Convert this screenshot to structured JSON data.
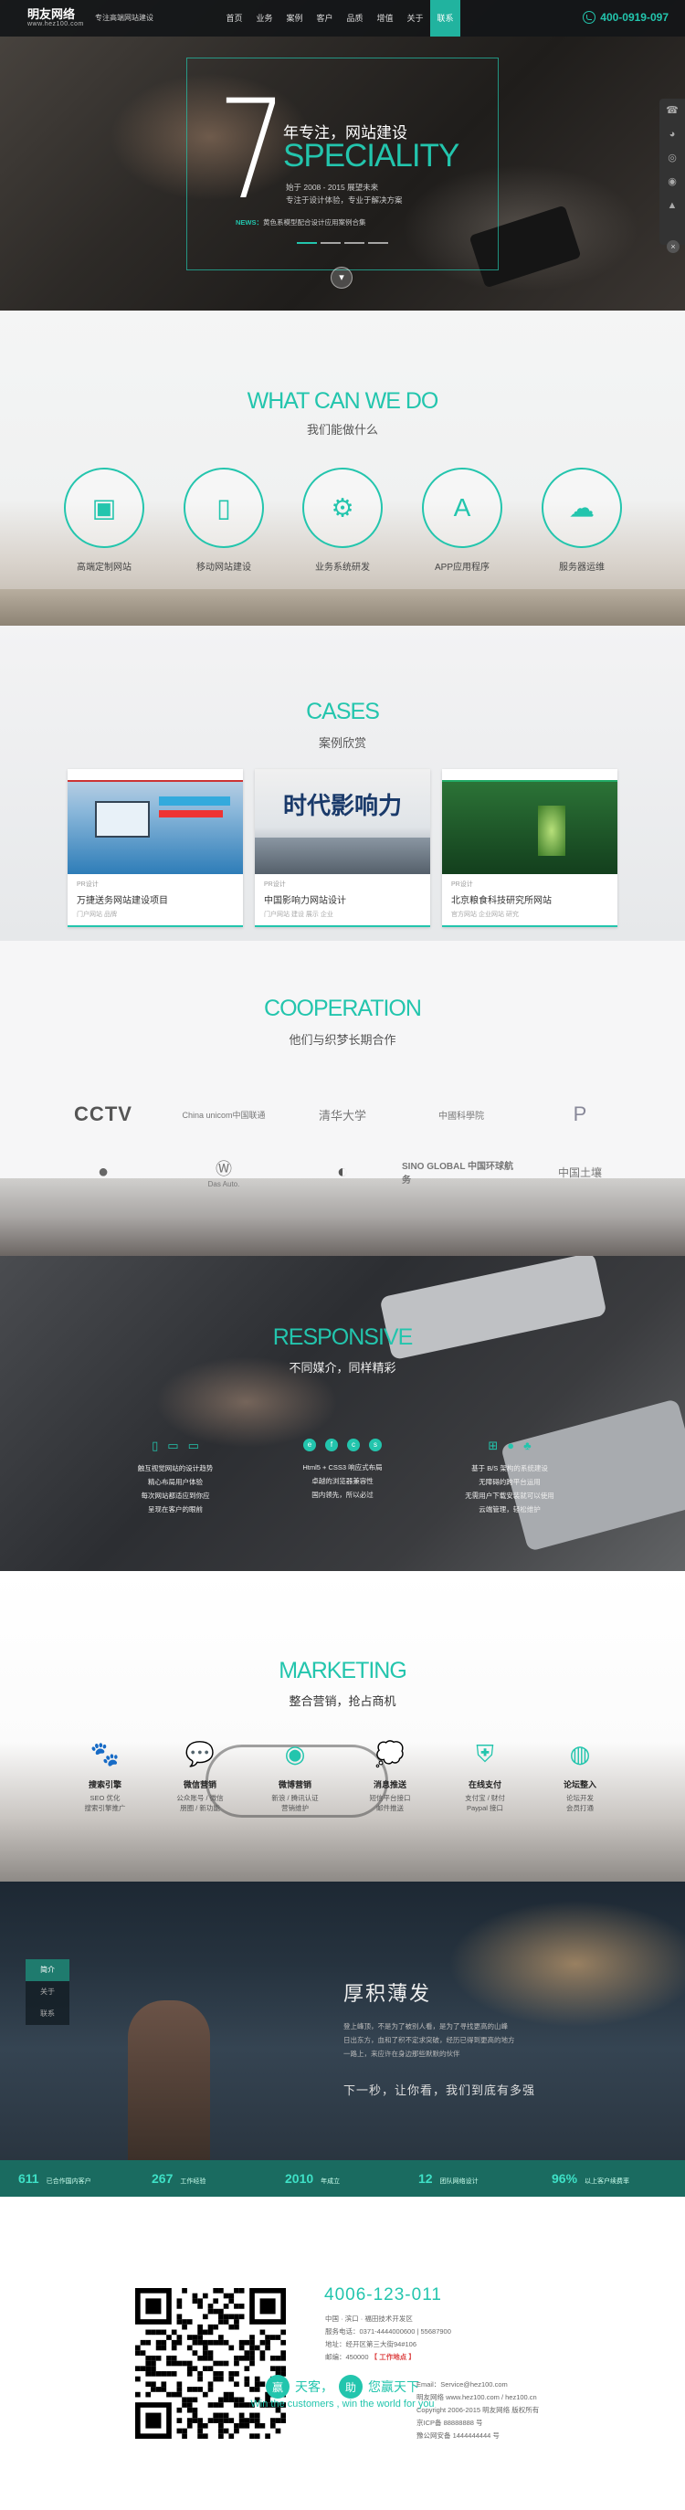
{
  "header": {
    "brand": "明友网络",
    "brand_url": "www.hez100.com",
    "slogan": "专注高端网站建设",
    "nav": [
      "首页",
      "业务",
      "案例",
      "客户",
      "品质",
      "增值",
      "关于",
      "联系"
    ],
    "phone": "400-0919-097"
  },
  "hero": {
    "big_number": "7",
    "line1": "年专注，网站建设",
    "speciality": "SPECIALITY",
    "small1": "始于 2008 - 2015 展望未来",
    "small2": "专注于设计体验，专业于解决方案",
    "news_label": "NEWS：",
    "news_text": "黄色系模型配合设计应用案例合集"
  },
  "what": {
    "title": "WHAT CAN WE DO",
    "subtitle": "我们能做什么",
    "services": [
      {
        "label": "高端定制网站",
        "icon": "browser-tools-icon"
      },
      {
        "label": "移动网站建设",
        "icon": "mobile-tablet-icon"
      },
      {
        "label": "业务系统研发",
        "icon": "system-gears-icon"
      },
      {
        "label": "APP应用程序",
        "icon": "app-store-icon"
      },
      {
        "label": "服务器运维",
        "icon": "cloud-server-icon"
      }
    ]
  },
  "cases": {
    "title": "CASES",
    "subtitle": "案例欣赏",
    "items": [
      {
        "tag": "PR设计",
        "title": "万捷送务网站建设项目",
        "sub": "门户网站 品牌"
      },
      {
        "tag": "PR设计",
        "title": "中国影响力网站设计",
        "sub": "门户网站 建设 展示 企业"
      },
      {
        "tag": "PR设计",
        "title": "北京粮食科技研究所网站",
        "sub": "官方网站 企业网站 研究"
      }
    ],
    "case2_banner": "时代影响力"
  },
  "coop": {
    "title": "COOPERATION",
    "subtitle": "他们与织梦长期合作",
    "logos": [
      "CCTV",
      "China unicom中国联通",
      "清华大学",
      "中國科學院",
      "",
      "Apple",
      "Das Auto.",
      "",
      "SINO GLOBAL 中国环球航务",
      "中国土壤"
    ]
  },
  "responsive": {
    "title": "RESPONSIVE",
    "subtitle": "不同媒介，同样精彩",
    "cols": [
      [
        "触互视觉网站的设计趋势",
        "精心布局用户体验",
        "每次网站都适应到你应",
        "呈现在客户的眼前"
      ],
      [
        "Html5 + CSS3 响应式布局",
        "卓越的浏览器兼容性",
        "国内领先，所以必过"
      ],
      [
        "基于 B/S 架构的系统建设",
        "无障碍的跨平台运用",
        "无需用户下载安装就可以使用",
        "云端管理，轻松维护"
      ]
    ]
  },
  "marketing": {
    "title": "MARKETING",
    "subtitle": "整合营销，抢占商机",
    "items": [
      {
        "name": "搜索引擎",
        "desc": [
          "SEO 优化",
          "搜索引擎推广"
        ],
        "icon": "paw-icon"
      },
      {
        "name": "微信营销",
        "desc": [
          "公众账号 / 微信",
          "朋圈 / 新功能"
        ],
        "icon": "wechat-icon"
      },
      {
        "name": "微博营销",
        "desc": [
          "新浪 / 腾讯认证",
          "营销维护"
        ],
        "icon": "weibo-icon"
      },
      {
        "name": "消息推送",
        "desc": [
          "短信平台接口",
          "邮件推送"
        ],
        "icon": "chat-icon"
      },
      {
        "name": "在线支付",
        "desc": [
          "支付宝 / 财付",
          "Paypal 接口"
        ],
        "icon": "shield-icon"
      },
      {
        "name": "论坛整入",
        "desc": [
          "论坛开发",
          "会员打通"
        ],
        "icon": "bbs-icon"
      }
    ]
  },
  "story": {
    "menu": [
      "简介",
      "关于",
      "联系"
    ],
    "title": "厚积薄发",
    "p1": "登上峰顶，不是为了被别人看，是为了寻找更高的山峰",
    "p2": "日出东方，血和了积不定求突破，经历已得到更高的地方",
    "p3": "一路上，来应许在身边那些默默的伙伴",
    "quote": "下一秒，让你看，我们到底有多强"
  },
  "stats": [
    {
      "num": "611",
      "label": "已合作国内客户"
    },
    {
      "num": "267",
      "label": "工作经验"
    },
    {
      "num": "2010",
      "label": "年成立"
    },
    {
      "num": "12",
      "label": "团队网络设计"
    },
    {
      "num": "96%",
      "label": "以上客户续费率"
    }
  ],
  "footer": {
    "tel": "4006-123-011",
    "addr1": "中国 · 滨口 · 福田技术开发区",
    "addr2": "服务电话：0371-4444000600 | 55687900",
    "addr3": "地址：经开区第三大街94#106",
    "addr4_label": "邮编：450000",
    "addr4_link": "【 工作地点 】",
    "email": "Email：Service@hez100.com",
    "site": "明友网络 www.hez100.com / hez100.cn",
    "copyright": "Copyright 2006-2015 明友网络 版权所有",
    "icp": "京ICP备 88888888 号",
    "icp2": "豫公网安备 1444444444 号",
    "slogan_a": "赢",
    "slogan_b": "天客，",
    "slogan_c": "助",
    "slogan_d": "您赢天下",
    "slogan_en": "Win the customers , win the world for you"
  },
  "side_tools": [
    "phone-icon",
    "qq-icon",
    "wechat-icon",
    "weibo-icon",
    "arrow-up-icon"
  ],
  "colors": {
    "accent": "#23c5ad",
    "dark": "#141618"
  }
}
